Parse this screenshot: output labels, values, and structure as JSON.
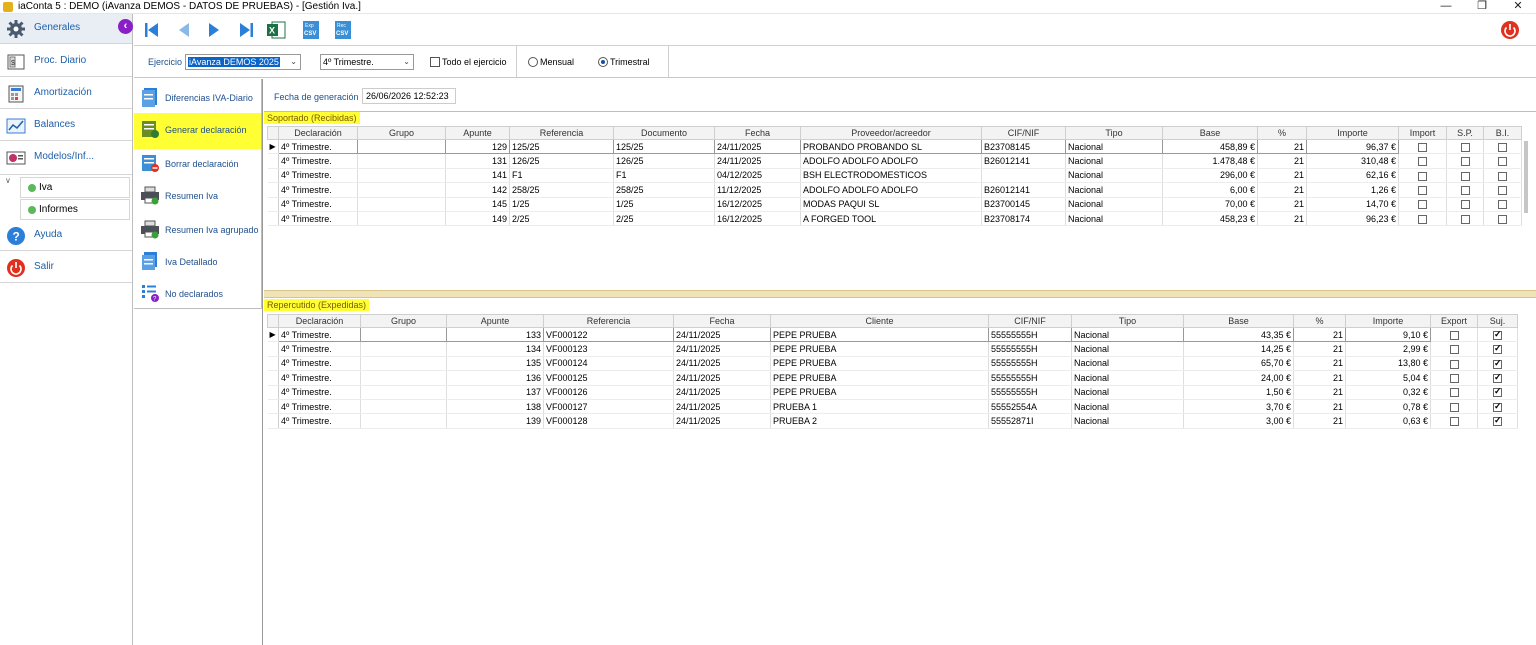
{
  "window": {
    "title": "iaConta 5 : DEMO (iAvanza DEMOS - DATOS DE PRUEBAS) - [Gestión Iva.]"
  },
  "sidebar": {
    "items": [
      {
        "label": "Generales"
      },
      {
        "label": "Proc. Diario"
      },
      {
        "label": "Amortización"
      },
      {
        "label": "Balances"
      },
      {
        "label": "Modelos/Inf..."
      },
      {
        "label": "Ayuda"
      },
      {
        "label": "Salir"
      }
    ],
    "sub_items": [
      {
        "label": "Iva"
      },
      {
        "label": "Informes"
      }
    ]
  },
  "toolbar": {
    "exp_csv": "Exp CSV",
    "rec_csv": "Rec CSV"
  },
  "filters": {
    "ejercicio_label": "Ejercicio",
    "ejercicio_value": "iAvanza DEMOS 2025",
    "periodo_value": "4º Trimestre.",
    "todo_label": "Todo el ejercicio",
    "mensual_label": "Mensual",
    "trimestral_label": "Trimestral"
  },
  "actions": [
    {
      "label": "Diferencias IVA-Diario"
    },
    {
      "label": "Generar declaración"
    },
    {
      "label": "Borrar declaración"
    },
    {
      "label": "Resumen Iva"
    },
    {
      "label": "Resumen Iva agrupado"
    },
    {
      "label": "Iva Detallado"
    },
    {
      "label": "No declarados"
    }
  ],
  "generation": {
    "label": "Fecha de generación",
    "value": "26/06/2026 12:52:23"
  },
  "soportado": {
    "title": "Soportado  (Recibidas)",
    "columns": [
      "Declaración",
      "Grupo",
      "Apunte",
      "Referencia",
      "Documento",
      "Fecha",
      "Proveedor/acreedor",
      "CIF/NIF",
      "Tipo",
      "Base",
      "%",
      "Importe",
      "Import",
      "S.P.",
      "B.I."
    ],
    "rows": [
      {
        "decl": "4º Trimestre.",
        "grupo": "",
        "apunte": "129",
        "ref": "125/25",
        "doc": "125/25",
        "fecha": "24/11/2025",
        "prov": "PROBANDO PROBANDO SL",
        "cif": "B23708145",
        "tipo": "Nacional",
        "base": "458,89 €",
        "pct": "21",
        "importe": "96,37 €"
      },
      {
        "decl": "4º Trimestre.",
        "grupo": "",
        "apunte": "131",
        "ref": "126/25",
        "doc": "126/25",
        "fecha": "24/11/2025",
        "prov": "ADOLFO ADOLFO ADOLFO",
        "cif": "B26012141",
        "tipo": "Nacional",
        "base": "1.478,48 €",
        "pct": "21",
        "importe": "310,48 €"
      },
      {
        "decl": "4º Trimestre.",
        "grupo": "",
        "apunte": "141",
        "ref": "F1",
        "doc": "F1",
        "fecha": "04/12/2025",
        "prov": "BSH ELECTRODOMESTICOS",
        "cif": "",
        "tipo": "Nacional",
        "base": "296,00 €",
        "pct": "21",
        "importe": "62,16 €"
      },
      {
        "decl": "4º Trimestre.",
        "grupo": "",
        "apunte": "142",
        "ref": "258/25",
        "doc": "258/25",
        "fecha": "11/12/2025",
        "prov": "ADOLFO ADOLFO ADOLFO",
        "cif": "B26012141",
        "tipo": "Nacional",
        "base": "6,00 €",
        "pct": "21",
        "importe": "1,26 €"
      },
      {
        "decl": "4º Trimestre.",
        "grupo": "",
        "apunte": "145",
        "ref": "1/25",
        "doc": "1/25",
        "fecha": "16/12/2025",
        "prov": "MODAS PAQUI SL",
        "cif": "B23700145",
        "tipo": "Nacional",
        "base": "70,00 €",
        "pct": "21",
        "importe": "14,70 €"
      },
      {
        "decl": "4º Trimestre.",
        "grupo": "",
        "apunte": "149",
        "ref": "2/25",
        "doc": "2/25",
        "fecha": "16/12/2025",
        "prov": "A FORGED TOOL",
        "cif": "B23708174",
        "tipo": "Nacional",
        "base": "458,23 €",
        "pct": "21",
        "importe": "96,23 €"
      }
    ]
  },
  "repercutido": {
    "title": "Repercutido  (Expedidas)",
    "columns": [
      "Declaración",
      "Grupo",
      "Apunte",
      "Referencia",
      "Fecha",
      "Cliente",
      "CIF/NIF",
      "Tipo",
      "Base",
      "%",
      "Importe",
      "Export",
      "Suj."
    ],
    "rows": [
      {
        "decl": "4º Trimestre.",
        "grupo": "",
        "apunte": "133",
        "ref": "VF000122",
        "fecha": "24/11/2025",
        "cliente": "PEPE PRUEBA",
        "cif": "55555555H",
        "tipo": "Nacional",
        "base": "43,35 €",
        "pct": "21",
        "importe": "9,10 €",
        "export": false,
        "suj": true
      },
      {
        "decl": "4º Trimestre.",
        "grupo": "",
        "apunte": "134",
        "ref": "VF000123",
        "fecha": "24/11/2025",
        "cliente": "PEPE PRUEBA",
        "cif": "55555555H",
        "tipo": "Nacional",
        "base": "14,25 €",
        "pct": "21",
        "importe": "2,99 €",
        "export": false,
        "suj": true
      },
      {
        "decl": "4º Trimestre.",
        "grupo": "",
        "apunte": "135",
        "ref": "VF000124",
        "fecha": "24/11/2025",
        "cliente": "PEPE PRUEBA",
        "cif": "55555555H",
        "tipo": "Nacional",
        "base": "65,70 €",
        "pct": "21",
        "importe": "13,80 €",
        "export": false,
        "suj": true
      },
      {
        "decl": "4º Trimestre.",
        "grupo": "",
        "apunte": "136",
        "ref": "VF000125",
        "fecha": "24/11/2025",
        "cliente": "PEPE PRUEBA",
        "cif": "55555555H",
        "tipo": "Nacional",
        "base": "24,00 €",
        "pct": "21",
        "importe": "5,04 €",
        "export": false,
        "suj": true
      },
      {
        "decl": "4º Trimestre.",
        "grupo": "",
        "apunte": "137",
        "ref": "VF000126",
        "fecha": "24/11/2025",
        "cliente": "PEPE PRUEBA",
        "cif": "55555555H",
        "tipo": "Nacional",
        "base": "1,50 €",
        "pct": "21",
        "importe": "0,32 €",
        "export": false,
        "suj": true
      },
      {
        "decl": "4º Trimestre.",
        "grupo": "",
        "apunte": "138",
        "ref": "VF000127",
        "fecha": "24/11/2025",
        "cliente": "PRUEBA 1",
        "cif": "55552554A",
        "tipo": "Nacional",
        "base": "3,70 €",
        "pct": "21",
        "importe": "0,78 €",
        "export": false,
        "suj": true
      },
      {
        "decl": "4º Trimestre.",
        "grupo": "",
        "apunte": "139",
        "ref": "VF000128",
        "fecha": "24/11/2025",
        "cliente": "PRUEBA 2",
        "cif": "55552871I",
        "tipo": "Nacional",
        "base": "3,00 €",
        "pct": "21",
        "importe": "0,63 €",
        "export": false,
        "suj": true
      }
    ]
  },
  "colors": {
    "highlight": "#ffff33",
    "accent": "#1f5fa8",
    "purple": "#8a1fc8",
    "power": "#e0301e",
    "divider": "#f1e3b8"
  },
  "icons": [
    "gear-icon",
    "journal-icon",
    "amortization-icon",
    "chart-icon",
    "reports-icon",
    "help-icon",
    "power-icon",
    "first-icon",
    "prev-icon",
    "next-icon",
    "last-icon",
    "excel-icon",
    "csv-export-icon",
    "csv-import-icon"
  ]
}
